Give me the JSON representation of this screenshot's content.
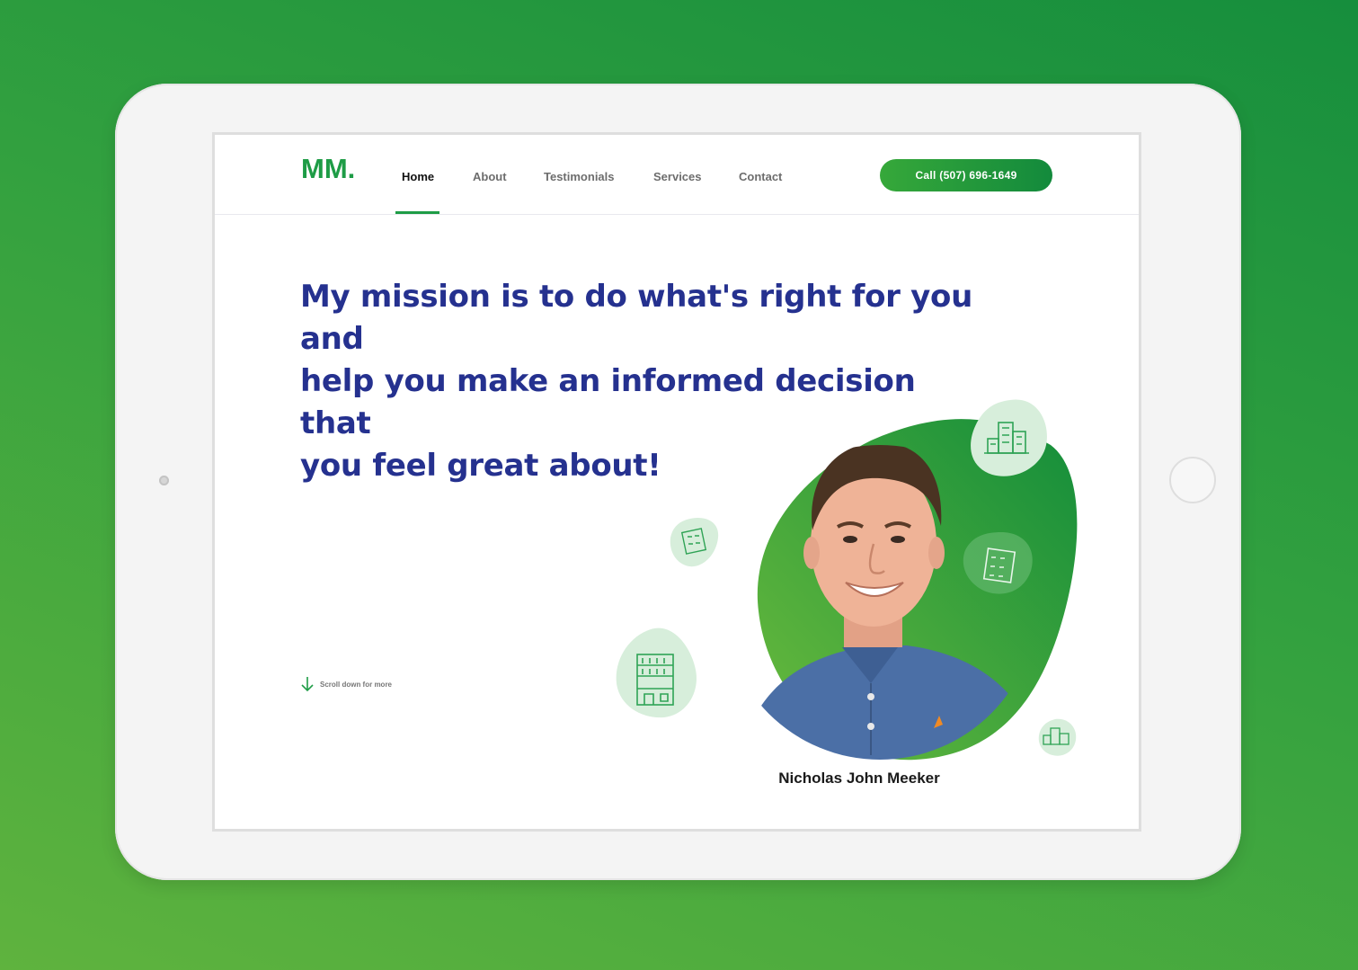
{
  "site": {
    "logo": "MM.",
    "nav": [
      {
        "label": "Home",
        "active": true
      },
      {
        "label": "About",
        "active": false
      },
      {
        "label": "Testimonials",
        "active": false
      },
      {
        "label": "Services",
        "active": false
      },
      {
        "label": "Contact",
        "active": false
      }
    ],
    "call_button": "Call (507) 696-1649"
  },
  "hero": {
    "headline_lines": [
      "My mission is to do what's right for you and",
      "help you make an informed decision that",
      "you feel great about!"
    ],
    "scroll_label": "Scroll down for more",
    "person_name": "Nicholas John Meeker"
  },
  "colors": {
    "brand_green": "#1e9c46",
    "headline_blue": "#25318f",
    "background_gradient": [
      "#168e3d",
      "#5fb33e"
    ]
  },
  "icons": [
    "building-icon",
    "arrow-down-icon",
    "portrait-photo"
  ]
}
